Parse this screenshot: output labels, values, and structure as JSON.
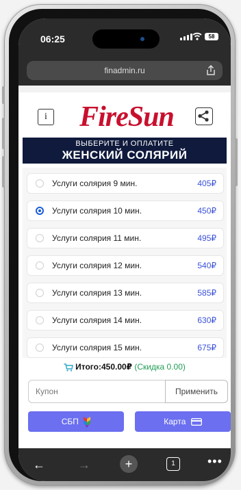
{
  "status": {
    "time": "06:25",
    "battery": "58"
  },
  "browser": {
    "url": "finadmin.ru"
  },
  "header": {
    "info_label": "i",
    "logo_text": "FireSun",
    "banner_line1": "ВЫБЕРИТЕ И ОПЛАТИТЕ",
    "banner_line2": "ЖЕНСКИЙ СОЛЯРИЙ"
  },
  "services": [
    {
      "label": "Услуги солярия 9 мин.",
      "price": "405₽",
      "selected": false
    },
    {
      "label": "Услуги солярия 10 мин.",
      "price": "450₽",
      "selected": true
    },
    {
      "label": "Услуги солярия 11 мин.",
      "price": "495₽",
      "selected": false
    },
    {
      "label": "Услуги солярия 12 мин.",
      "price": "540₽",
      "selected": false
    },
    {
      "label": "Услуги солярия 13 мин.",
      "price": "585₽",
      "selected": false
    },
    {
      "label": "Услуги солярия 14 мин.",
      "price": "630₽",
      "selected": false
    },
    {
      "label": "Услуги солярия 15 мин.",
      "price": "675₽",
      "selected": false
    }
  ],
  "summary": {
    "total": "Итого:450.00₽",
    "discount": "(Скидка 0.00)"
  },
  "coupon": {
    "placeholder": "Купон",
    "apply_label": "Применить"
  },
  "payment": {
    "sbp_label": "СБП",
    "card_label": "Карта"
  },
  "toolbar": {
    "back": "←",
    "forward": "→",
    "new_tab": "+",
    "tab_count": "1",
    "more": "•••"
  },
  "colors": {
    "accent": "#6b6ff0",
    "price": "#3b52d9",
    "logo": "#c8102e",
    "banner": "#0f1a3c",
    "discount": "#1f9d55"
  },
  "icons": [
    "signal-icon",
    "wifi-icon",
    "battery-icon",
    "share-icon",
    "info-icon",
    "cart-icon",
    "sbp-logo-icon",
    "card-icon"
  ]
}
